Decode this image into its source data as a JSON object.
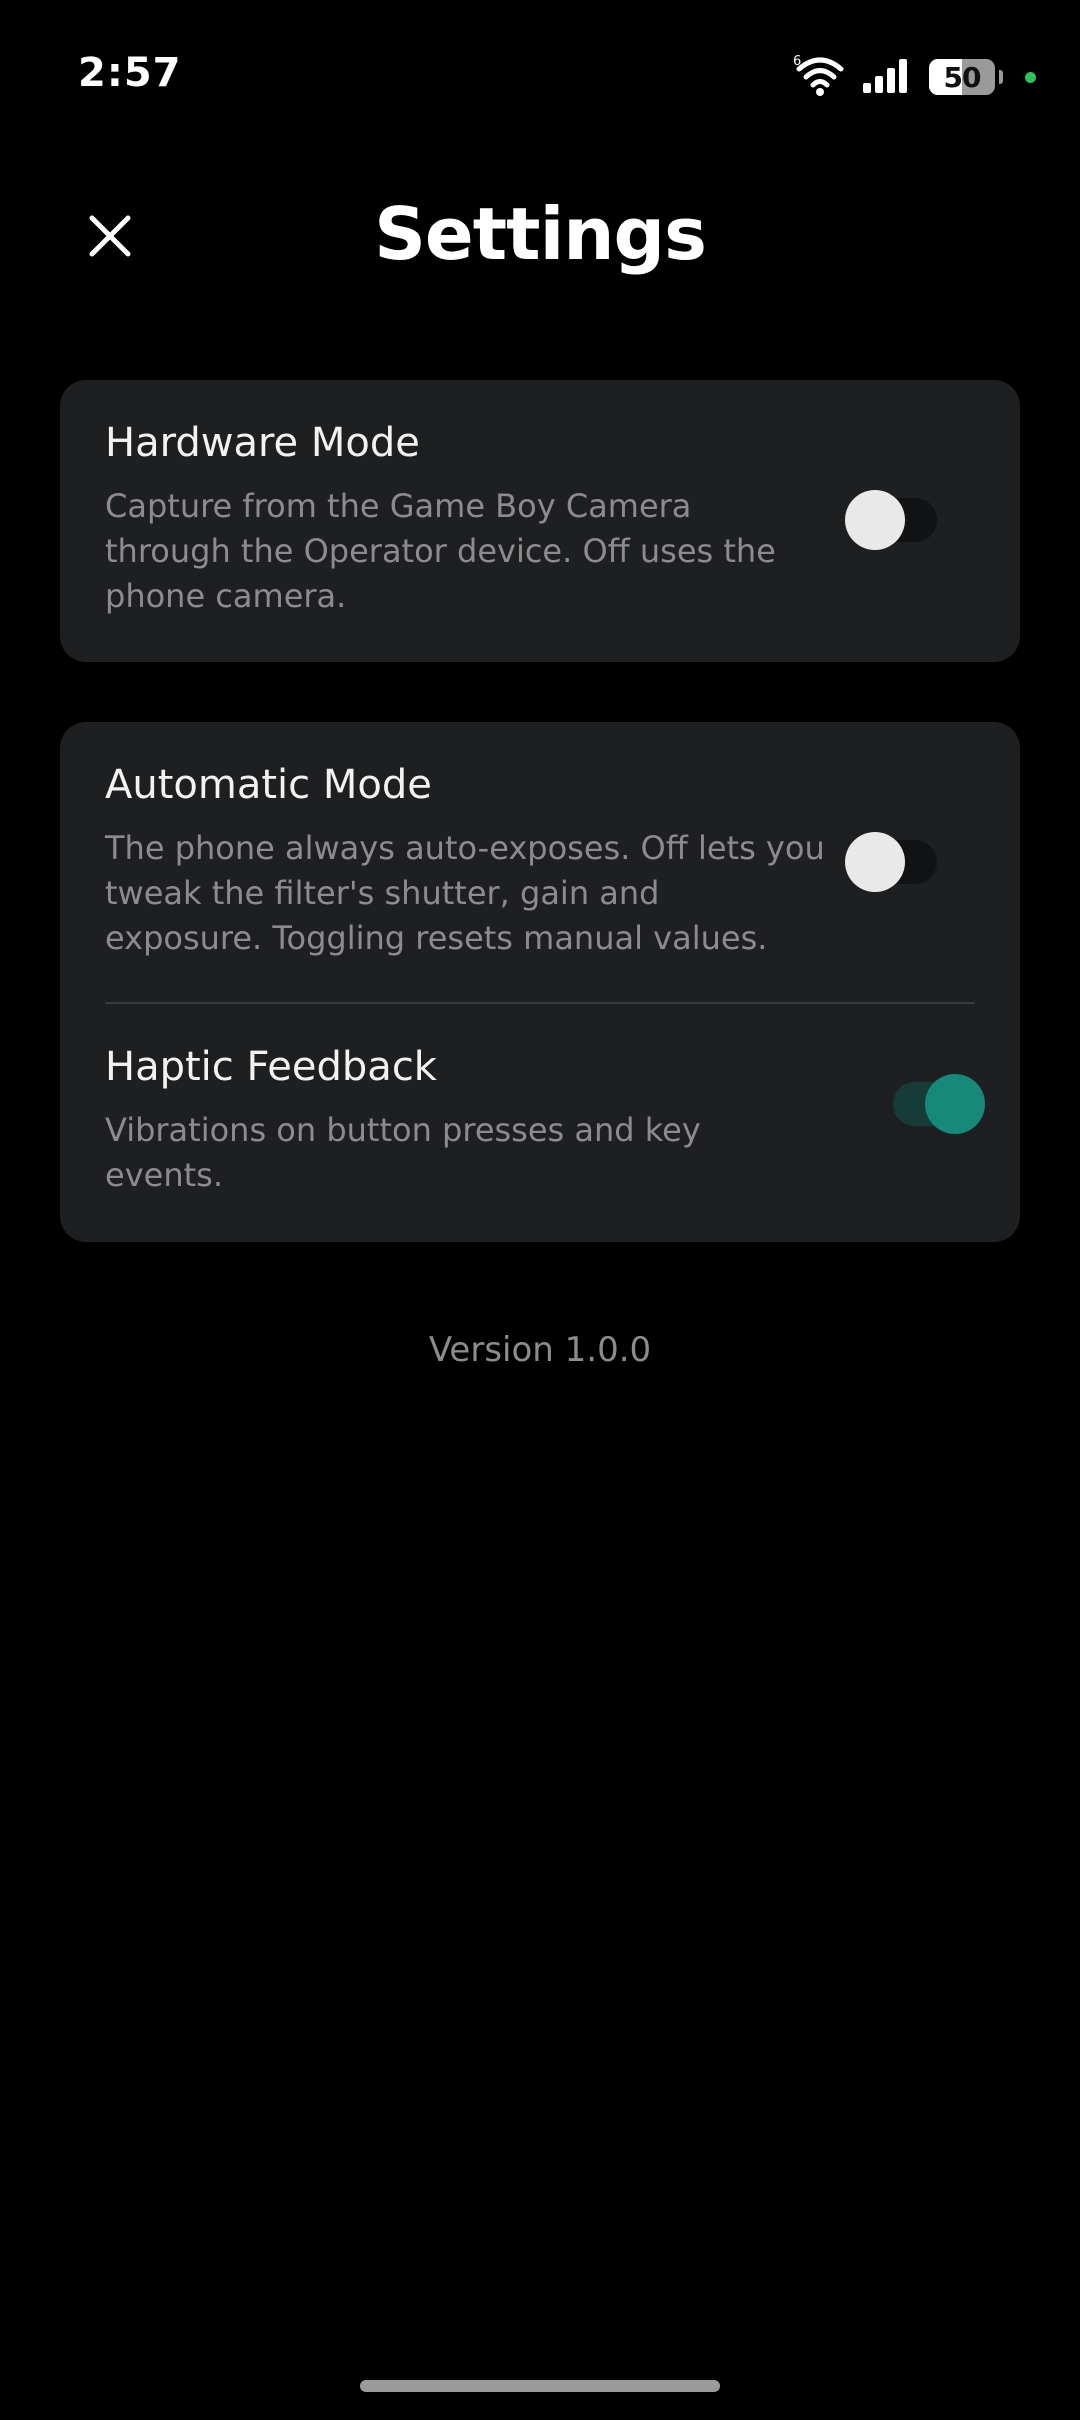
{
  "status_bar": {
    "time": "2:57",
    "wifi_icon": "wifi-icon",
    "wifi_badge": "6",
    "signal_icon": "cellular-signal-icon",
    "battery_level": "50",
    "battery_fraction": 0.5,
    "indicator_color": "#2fc35a"
  },
  "header": {
    "title": "Settings",
    "close_icon": "close-icon"
  },
  "settings": {
    "hardware_mode": {
      "title": "Hardware Mode",
      "description": "Capture from the Game Boy Camera through the Operator device. Off uses the phone camera.",
      "enabled": false
    },
    "automatic_mode": {
      "title": "Automatic Mode",
      "description": "The phone always auto-exposes. Off lets you tweak the filter's shutter, gain and exposure. Toggling resets manual values.",
      "enabled": false
    },
    "haptic_feedback": {
      "title": "Haptic Feedback",
      "description": "Vibrations on button presses and key events.",
      "enabled": true
    }
  },
  "footer": {
    "version": "Version 1.0.0"
  },
  "colors": {
    "background": "#000000",
    "card": "#1e1f21",
    "accent": "#16897a",
    "secondary_text": "#8c8c8e"
  }
}
